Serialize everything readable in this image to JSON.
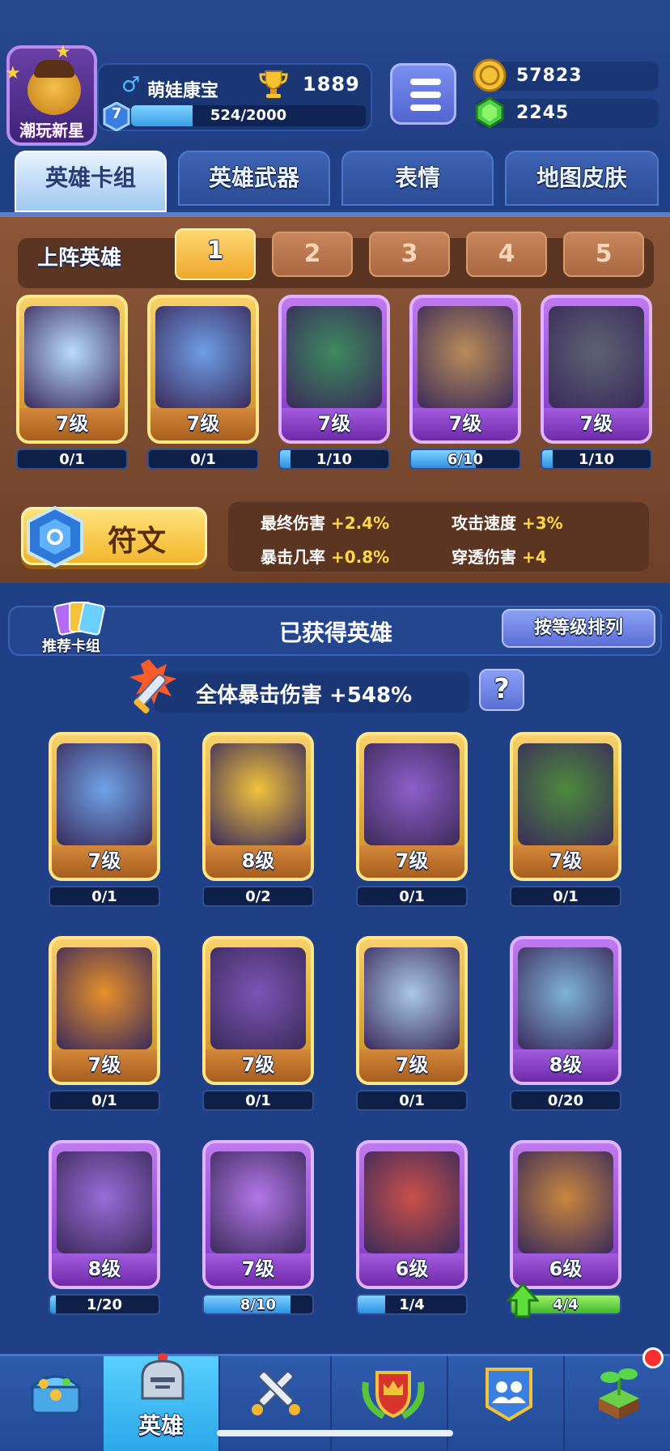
{
  "player": {
    "badge": "潮玩新星",
    "name": "萌娃康宝",
    "trophies": "1889",
    "level": "7",
    "xp": "524/2000",
    "xp_fraction": 0.262
  },
  "currencies": {
    "gold": "57823",
    "gems": "2245"
  },
  "tabs": [
    "英雄卡组",
    "英雄武器",
    "表情",
    "地图皮肤"
  ],
  "loadout": {
    "title": "上阵英雄",
    "slots": [
      "1",
      "2",
      "3",
      "4",
      "5"
    ],
    "heroes": [
      {
        "level": "7级",
        "progress": "0/1",
        "fraction": 0,
        "rarity": "gold",
        "color": "#b9dcff"
      },
      {
        "level": "7级",
        "progress": "0/1",
        "fraction": 0,
        "rarity": "gold",
        "color": "#6f9ee6"
      },
      {
        "level": "7级",
        "progress": "1/10",
        "fraction": 0.1,
        "rarity": "purple",
        "color": "#3d8a5e"
      },
      {
        "level": "7级",
        "progress": "6/10",
        "fraction": 0.6,
        "rarity": "purple",
        "color": "#b88c58"
      },
      {
        "level": "7级",
        "progress": "1/10",
        "fraction": 0.1,
        "rarity": "purple",
        "color": "#5d6272"
      }
    ]
  },
  "rune": {
    "label": "符文"
  },
  "stats": [
    {
      "label": "最终伤害",
      "value": "+2.4%"
    },
    {
      "label": "攻击速度",
      "value": "+3%"
    },
    {
      "label": "暴击几率",
      "value": "+0.8%"
    },
    {
      "label": "穿透伤害",
      "value": "+4"
    }
  ],
  "owned": {
    "deck_label": "推荐卡组",
    "title": "已获得英雄",
    "sort_label": "按等级排列",
    "crit_text": "全体暴击伤害 +548%",
    "help": "?",
    "heroes": [
      {
        "level": "7级",
        "progress": "0/1",
        "fraction": 0,
        "rarity": "gold",
        "color": "#6fa3e8"
      },
      {
        "level": "8级",
        "progress": "0/2",
        "fraction": 0,
        "rarity": "gold",
        "color": "#f1c33c"
      },
      {
        "level": "7级",
        "progress": "0/1",
        "fraction": 0,
        "rarity": "gold",
        "color": "#8f5fc9"
      },
      {
        "level": "7级",
        "progress": "0/1",
        "fraction": 0,
        "rarity": "gold",
        "color": "#4e8a3c"
      },
      {
        "level": "7级",
        "progress": "0/1",
        "fraction": 0,
        "rarity": "gold",
        "color": "#e8902a"
      },
      {
        "level": "7级",
        "progress": "0/1",
        "fraction": 0,
        "rarity": "gold",
        "color": "#7b55b5"
      },
      {
        "level": "7级",
        "progress": "0/1",
        "fraction": 0,
        "rarity": "gold",
        "color": "#a9c8e8"
      },
      {
        "level": "8级",
        "progress": "0/20",
        "fraction": 0,
        "rarity": "purple",
        "color": "#7fb3d9"
      },
      {
        "level": "8级",
        "progress": "1/20",
        "fraction": 0.05,
        "rarity": "purple",
        "color": "#9a6cd8"
      },
      {
        "level": "7级",
        "progress": "8/10",
        "fraction": 0.8,
        "rarity": "purple",
        "color": "#b377e8"
      },
      {
        "level": "6级",
        "progress": "1/4",
        "fraction": 0.25,
        "rarity": "purple",
        "color": "#c9504a"
      },
      {
        "level": "6级",
        "progress": "4/4",
        "fraction": 1,
        "rarity": "purple",
        "color": "#c8873e",
        "upgradable": true
      }
    ]
  },
  "nav": {
    "active_label": "英雄"
  }
}
